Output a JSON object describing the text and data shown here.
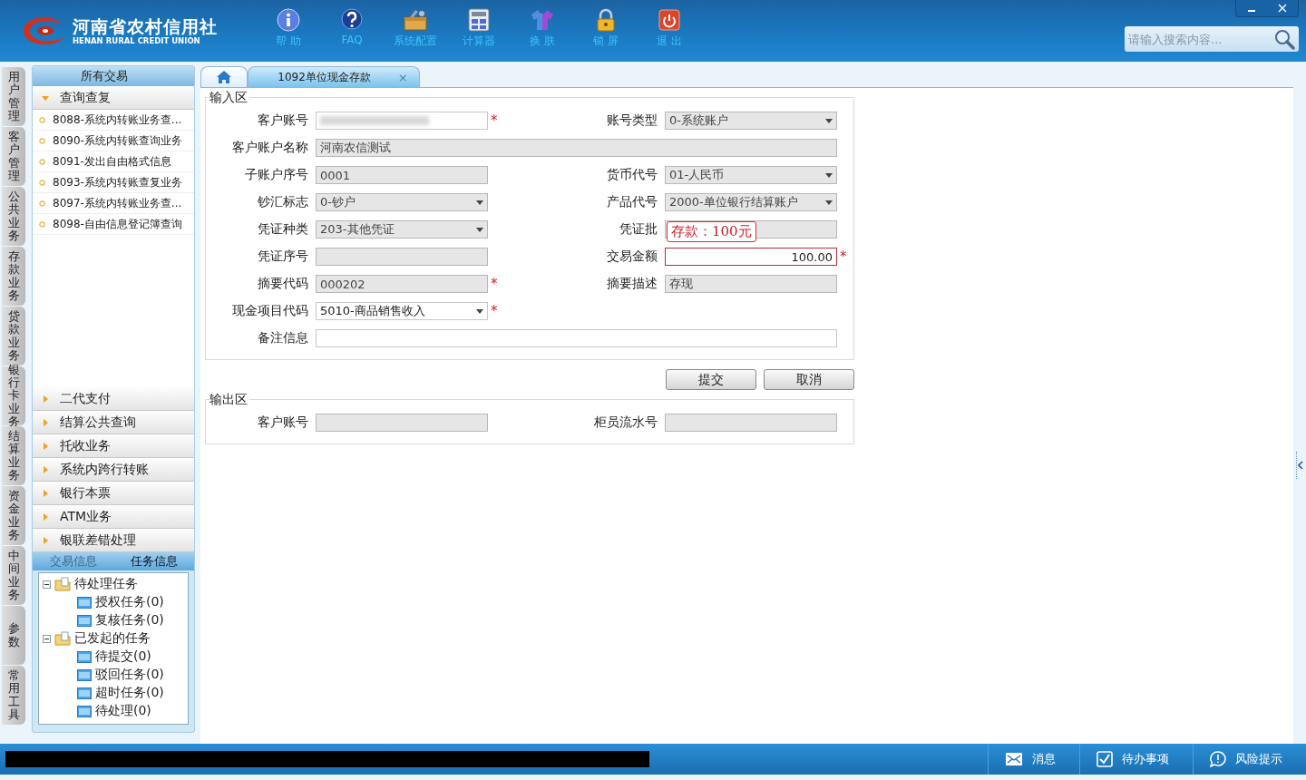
{
  "header": {
    "logo_title": "河南省农村信用社",
    "logo_subtitle": "HENAN RURAL CREDIT UNION",
    "tools": [
      {
        "label": "帮 助"
      },
      {
        "label": "FAQ"
      },
      {
        "label": "系统配置"
      },
      {
        "label": "计算器"
      },
      {
        "label": "换 肤"
      },
      {
        "label": "锁 屏"
      },
      {
        "label": "退 出"
      }
    ],
    "search": {
      "placeholder": "请输入搜索内容..."
    }
  },
  "side_tabs": [
    "用户管理",
    "客户管理",
    "公共业务",
    "存款业务",
    "贷款业务",
    "银行卡业务",
    "结算业务",
    "资金业务",
    "中间业务",
    "参数",
    "常用工具"
  ],
  "sidebar": {
    "title": "所有交易",
    "groups": [
      {
        "label": "查询查复",
        "expanded": true,
        "items": [
          "8088-系统内转账业务查...",
          "8090-系统内转账查询业务",
          "8091-发出自由格式信息",
          "8093-系统内转账查复业务",
          "8097-系统内转账业务查...",
          "8098-自由信息登记簿查询"
        ]
      },
      {
        "label": "二代支付",
        "expanded": false
      },
      {
        "label": "结算公共查询",
        "expanded": false
      },
      {
        "label": "托收业务",
        "expanded": false
      },
      {
        "label": "系统内跨行转账",
        "expanded": false
      },
      {
        "label": "银行本票",
        "expanded": false
      },
      {
        "label": "ATM业务",
        "expanded": false
      },
      {
        "label": "银联差错处理",
        "expanded": false
      }
    ],
    "info_tabs": [
      {
        "label": "交易信息",
        "selected": false
      },
      {
        "label": "任务信息",
        "selected": true
      }
    ],
    "tree": [
      {
        "label": "待处理任务",
        "expanded": true,
        "children": [
          {
            "label": "授权任务(0)"
          },
          {
            "label": "复核任务(0)"
          }
        ]
      },
      {
        "label": "已发起的任务",
        "expanded": true,
        "children": [
          {
            "label": "待提交(0)"
          },
          {
            "label": "驳回任务(0)"
          },
          {
            "label": "超时任务(0)"
          },
          {
            "label": "待处理(0)"
          }
        ]
      }
    ]
  },
  "tabs": [
    {
      "kind": "home",
      "selected": false
    },
    {
      "kind": "page",
      "label": "1092单位现金存款",
      "close": "×",
      "selected": true
    }
  ],
  "input_section": {
    "legend": "输入区",
    "rows": [
      {
        "kind": "pair",
        "fields": [
          {
            "label": "客户账号",
            "kind": "text",
            "disabled": false,
            "required_mark": "*",
            "blurred": true
          },
          {
            "label": "账号类型",
            "kind": "select",
            "disabled": true,
            "value": "0-系统账户"
          }
        ]
      },
      {
        "kind": "wide",
        "fields": [
          {
            "label": "客户账户名称",
            "kind": "text",
            "disabled": true,
            "value": "河南农信测试"
          }
        ]
      },
      {
        "kind": "pair",
        "fields": [
          {
            "label": "子账户序号",
            "kind": "text",
            "disabled": true,
            "value": "0001"
          },
          {
            "label": "货币代号",
            "kind": "select",
            "disabled": true,
            "value": "01-人民币"
          }
        ]
      },
      {
        "kind": "pair",
        "fields": [
          {
            "label": "钞汇标志",
            "kind": "select",
            "disabled": true,
            "value": "0-钞户"
          },
          {
            "label": "产品代号",
            "kind": "select",
            "disabled": true,
            "value": "2000-单位银行结算账户"
          }
        ]
      },
      {
        "kind": "pair",
        "fields": [
          {
            "label": "凭证种类",
            "kind": "select",
            "disabled": true,
            "value": "203-其他凭证"
          },
          {
            "label": "凭证批",
            "kind": "text",
            "disabled": true
          }
        ]
      },
      {
        "kind": "pair",
        "fields": [
          {
            "label": "凭证序号",
            "kind": "text",
            "disabled": true
          },
          {
            "label": "交易金额",
            "kind": "text",
            "disabled": false,
            "focused": true,
            "required_mark": "*",
            "value": "100.00",
            "tooltip": "存款：100元"
          }
        ]
      },
      {
        "kind": "pair",
        "fields": [
          {
            "label": "摘要代码",
            "kind": "text",
            "disabled": true,
            "required_mark": "*",
            "value": "000202"
          },
          {
            "label": "摘要描述",
            "kind": "text",
            "disabled": true,
            "value": "存现"
          }
        ]
      },
      {
        "kind": "pair",
        "fields": [
          {
            "label": "现金项目代码",
            "kind": "select",
            "disabled": false,
            "required_mark": "*",
            "value": "5010-商品销售收入"
          }
        ]
      },
      {
        "kind": "wide",
        "fields": [
          {
            "label": "备注信息",
            "kind": "text",
            "disabled": false
          }
        ]
      }
    ]
  },
  "buttons": [
    "提交",
    "取消"
  ],
  "output_section": {
    "legend": "输出区",
    "rows": [
      {
        "kind": "pair",
        "fields": [
          {
            "label": "客户账号",
            "kind": "text",
            "disabled": true
          },
          {
            "label": "柜员流水号",
            "kind": "text",
            "disabled": true
          }
        ]
      }
    ]
  },
  "status_bar": {
    "redacted": true,
    "items": [
      {
        "label": "消息"
      },
      {
        "label": "待办事项"
      },
      {
        "label": "风险提示"
      }
    ]
  }
}
